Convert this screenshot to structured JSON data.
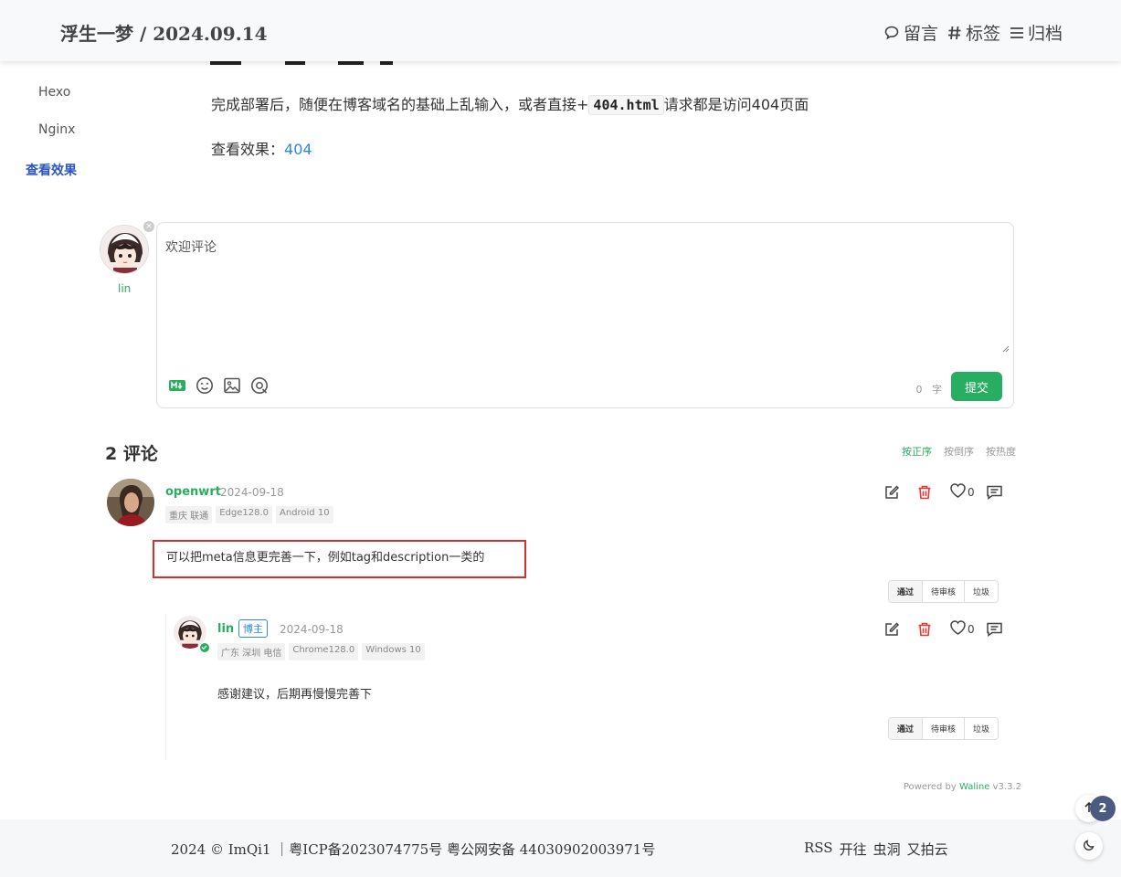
{
  "header": {
    "title": "浮生一梦 / 2024.09.14",
    "nav": [
      {
        "label": "留言",
        "icon": "message-icon"
      },
      {
        "label": "标签",
        "icon": "hash-icon"
      },
      {
        "label": "归档",
        "icon": "list-icon"
      }
    ]
  },
  "toc": {
    "items": [
      {
        "label": "Hexo"
      },
      {
        "label": "Nginx"
      },
      {
        "label": "查看效果"
      }
    ]
  },
  "article": {
    "para1_prefix": "完成部署后，随便在博客域名的基础上乱输入，或者直接+",
    "para1_code": "404.html",
    "para1_suffix": "请求都是访问404页面",
    "para2_prefix": "查看效果：",
    "para2_link": "404"
  },
  "comment_box": {
    "user_name": "lin",
    "placeholder": "欢迎评论",
    "word_count": "0",
    "word_unit": "字",
    "submit_label": "提交",
    "tools": [
      "markdown-icon",
      "emoji-icon",
      "image-icon",
      "mention-icon"
    ]
  },
  "comments_header": {
    "count": "2",
    "count_label": "评论",
    "sorts": [
      "按正序",
      "按倒序",
      "按热度"
    ],
    "active_sort": "按正序"
  },
  "comments": [
    {
      "nick": "openwrt",
      "date": "2024-09-18",
      "meta": [
        "重庆 联通",
        "Edge128.0",
        "Android 10"
      ],
      "likes": "0",
      "content": "可以把meta信息更完善一下，例如tag和description一类的",
      "admin": [
        "通过",
        "待审核",
        "垃圾"
      ]
    },
    {
      "nick": "lin",
      "badge": "博主",
      "date": "2024-09-18",
      "meta": [
        "广东 深圳 电信",
        "Chrome128.0",
        "Windows 10"
      ],
      "likes": "0",
      "content": "感谢建议，后期再慢慢完善下",
      "admin": [
        "通过",
        "待审核",
        "垃圾"
      ]
    }
  ],
  "powered": {
    "prefix": "Powered by",
    "brand": "Waline",
    "version": "v3.3.2"
  },
  "footer": {
    "left": "2024 © ImQi1 ｜粤ICP备2023074775号 粤公网安备 44030902003971号",
    "links": [
      "RSS",
      "开往",
      "虫洞",
      "又拍云"
    ]
  },
  "floating": {
    "badge": "2"
  },
  "colors": {
    "accent_green": "#27ae60",
    "toc_active": "#2e55c6",
    "link_blue": "#2e86de",
    "delete_red": "#e53935",
    "highlight_red": "#d32f2f"
  }
}
